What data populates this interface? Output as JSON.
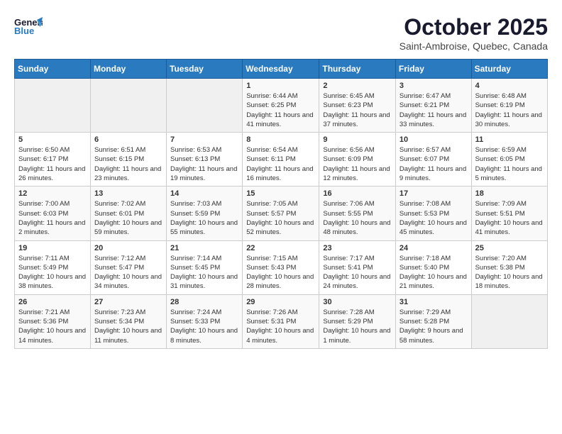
{
  "header": {
    "logo_general": "General",
    "logo_blue": "Blue",
    "month_title": "October 2025",
    "location": "Saint-Ambroise, Quebec, Canada"
  },
  "days_of_week": [
    "Sunday",
    "Monday",
    "Tuesday",
    "Wednesday",
    "Thursday",
    "Friday",
    "Saturday"
  ],
  "weeks": [
    [
      {
        "day": "",
        "empty": true
      },
      {
        "day": "",
        "empty": true
      },
      {
        "day": "",
        "empty": true
      },
      {
        "day": "1",
        "sunrise": "6:44 AM",
        "sunset": "6:25 PM",
        "daylight": "11 hours and 41 minutes."
      },
      {
        "day": "2",
        "sunrise": "6:45 AM",
        "sunset": "6:23 PM",
        "daylight": "11 hours and 37 minutes."
      },
      {
        "day": "3",
        "sunrise": "6:47 AM",
        "sunset": "6:21 PM",
        "daylight": "11 hours and 33 minutes."
      },
      {
        "day": "4",
        "sunrise": "6:48 AM",
        "sunset": "6:19 PM",
        "daylight": "11 hours and 30 minutes."
      }
    ],
    [
      {
        "day": "5",
        "sunrise": "6:50 AM",
        "sunset": "6:17 PM",
        "daylight": "11 hours and 26 minutes."
      },
      {
        "day": "6",
        "sunrise": "6:51 AM",
        "sunset": "6:15 PM",
        "daylight": "11 hours and 23 minutes."
      },
      {
        "day": "7",
        "sunrise": "6:53 AM",
        "sunset": "6:13 PM",
        "daylight": "11 hours and 19 minutes."
      },
      {
        "day": "8",
        "sunrise": "6:54 AM",
        "sunset": "6:11 PM",
        "daylight": "11 hours and 16 minutes."
      },
      {
        "day": "9",
        "sunrise": "6:56 AM",
        "sunset": "6:09 PM",
        "daylight": "11 hours and 12 minutes."
      },
      {
        "day": "10",
        "sunrise": "6:57 AM",
        "sunset": "6:07 PM",
        "daylight": "11 hours and 9 minutes."
      },
      {
        "day": "11",
        "sunrise": "6:59 AM",
        "sunset": "6:05 PM",
        "daylight": "11 hours and 5 minutes."
      }
    ],
    [
      {
        "day": "12",
        "sunrise": "7:00 AM",
        "sunset": "6:03 PM",
        "daylight": "11 hours and 2 minutes."
      },
      {
        "day": "13",
        "sunrise": "7:02 AM",
        "sunset": "6:01 PM",
        "daylight": "10 hours and 59 minutes."
      },
      {
        "day": "14",
        "sunrise": "7:03 AM",
        "sunset": "5:59 PM",
        "daylight": "10 hours and 55 minutes."
      },
      {
        "day": "15",
        "sunrise": "7:05 AM",
        "sunset": "5:57 PM",
        "daylight": "10 hours and 52 minutes."
      },
      {
        "day": "16",
        "sunrise": "7:06 AM",
        "sunset": "5:55 PM",
        "daylight": "10 hours and 48 minutes."
      },
      {
        "day": "17",
        "sunrise": "7:08 AM",
        "sunset": "5:53 PM",
        "daylight": "10 hours and 45 minutes."
      },
      {
        "day": "18",
        "sunrise": "7:09 AM",
        "sunset": "5:51 PM",
        "daylight": "10 hours and 41 minutes."
      }
    ],
    [
      {
        "day": "19",
        "sunrise": "7:11 AM",
        "sunset": "5:49 PM",
        "daylight": "10 hours and 38 minutes."
      },
      {
        "day": "20",
        "sunrise": "7:12 AM",
        "sunset": "5:47 PM",
        "daylight": "10 hours and 34 minutes."
      },
      {
        "day": "21",
        "sunrise": "7:14 AM",
        "sunset": "5:45 PM",
        "daylight": "10 hours and 31 minutes."
      },
      {
        "day": "22",
        "sunrise": "7:15 AM",
        "sunset": "5:43 PM",
        "daylight": "10 hours and 28 minutes."
      },
      {
        "day": "23",
        "sunrise": "7:17 AM",
        "sunset": "5:41 PM",
        "daylight": "10 hours and 24 minutes."
      },
      {
        "day": "24",
        "sunrise": "7:18 AM",
        "sunset": "5:40 PM",
        "daylight": "10 hours and 21 minutes."
      },
      {
        "day": "25",
        "sunrise": "7:20 AM",
        "sunset": "5:38 PM",
        "daylight": "10 hours and 18 minutes."
      }
    ],
    [
      {
        "day": "26",
        "sunrise": "7:21 AM",
        "sunset": "5:36 PM",
        "daylight": "10 hours and 14 minutes."
      },
      {
        "day": "27",
        "sunrise": "7:23 AM",
        "sunset": "5:34 PM",
        "daylight": "10 hours and 11 minutes."
      },
      {
        "day": "28",
        "sunrise": "7:24 AM",
        "sunset": "5:33 PM",
        "daylight": "10 hours and 8 minutes."
      },
      {
        "day": "29",
        "sunrise": "7:26 AM",
        "sunset": "5:31 PM",
        "daylight": "10 hours and 4 minutes."
      },
      {
        "day": "30",
        "sunrise": "7:28 AM",
        "sunset": "5:29 PM",
        "daylight": "10 hours and 1 minute."
      },
      {
        "day": "31",
        "sunrise": "7:29 AM",
        "sunset": "5:28 PM",
        "daylight": "9 hours and 58 minutes."
      },
      {
        "day": "",
        "empty": true
      }
    ]
  ]
}
